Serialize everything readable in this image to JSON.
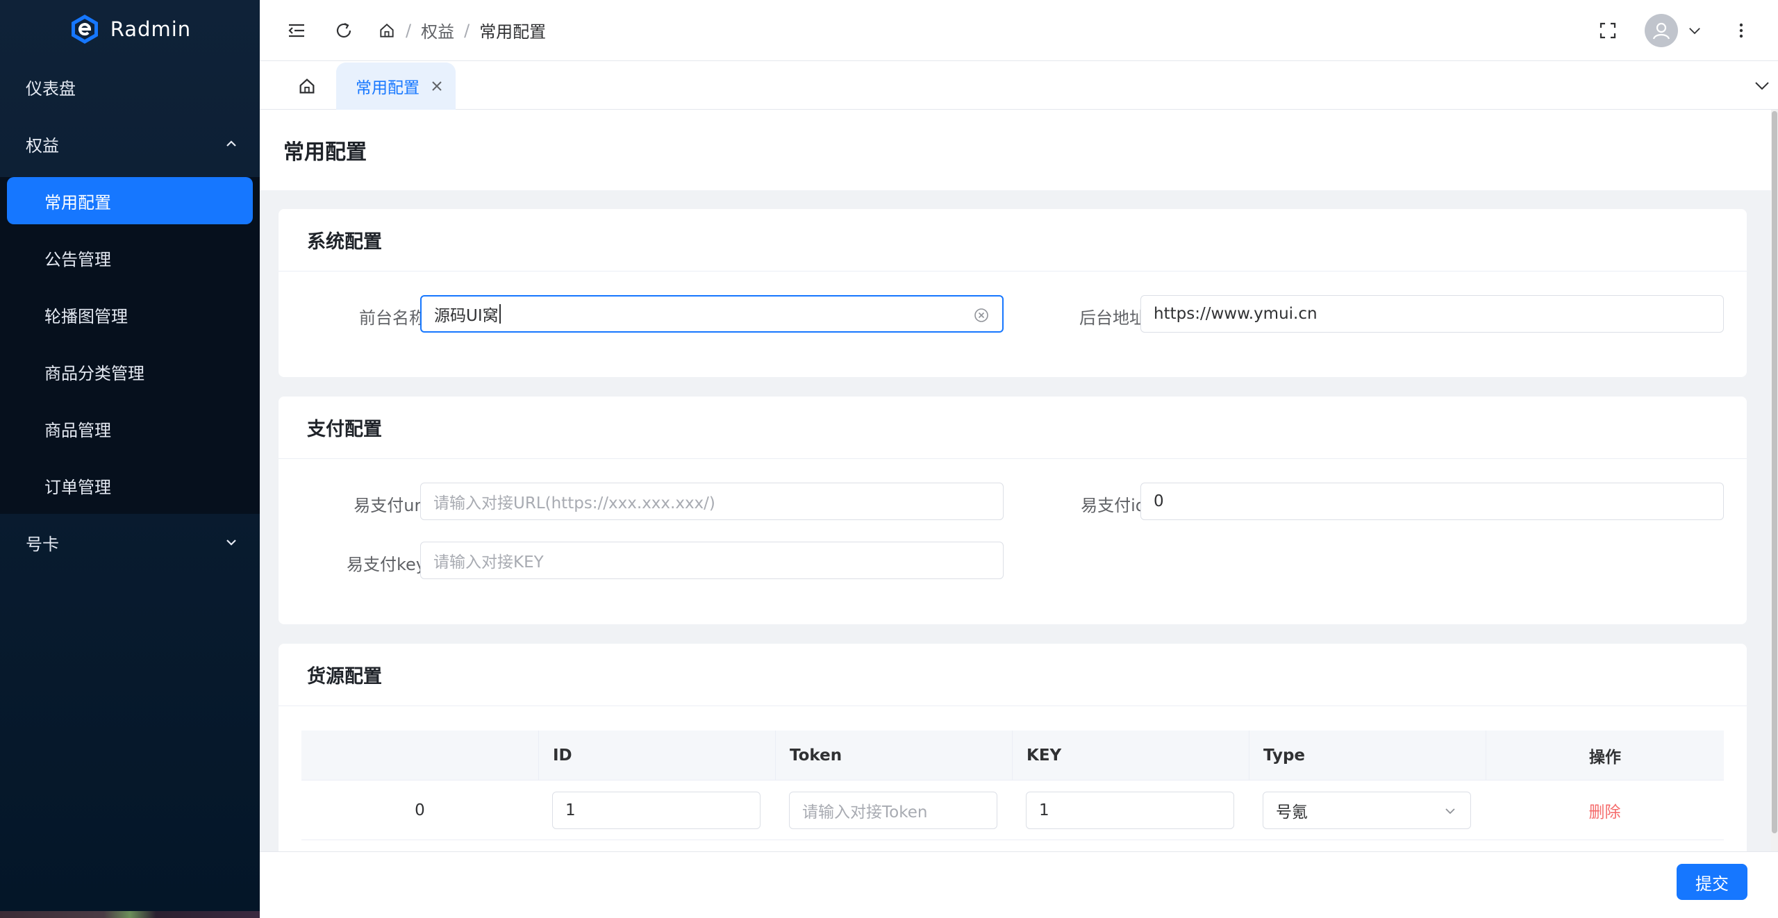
{
  "app": {
    "name": "Radmin"
  },
  "sidebar": {
    "items": [
      {
        "label": "仪表盘"
      },
      {
        "label": "权益",
        "expanded": true,
        "children": [
          {
            "label": "常用配置",
            "active": true
          },
          {
            "label": "公告管理"
          },
          {
            "label": "轮播图管理"
          },
          {
            "label": "商品分类管理"
          },
          {
            "label": "商品管理"
          },
          {
            "label": "订单管理"
          }
        ]
      },
      {
        "label": "号卡",
        "expanded": false
      }
    ]
  },
  "header": {
    "breadcrumb": [
      "权益",
      "常用配置"
    ],
    "separator": "/"
  },
  "tabs": [
    {
      "label": "常用配置",
      "active": true
    }
  ],
  "page": {
    "title": "常用配置"
  },
  "sections": {
    "system": {
      "title": "系统配置",
      "frontend_name_label": "前台名称",
      "frontend_name_value": "源码UI窝",
      "backend_url_label": "后台地址",
      "backend_url_value": "https://www.ymui.cn"
    },
    "payment": {
      "title": "支付配置",
      "url_label": "易支付url",
      "url_placeholder": "请输入对接URL(https://xxx.xxx.xxx/)",
      "id_label": "易支付id",
      "id_value": "0",
      "key_label": "易支付key",
      "key_placeholder": "请输入对接KEY"
    },
    "supply": {
      "title": "货源配置",
      "columns": [
        "",
        "ID",
        "Token",
        "KEY",
        "Type",
        "操作"
      ],
      "rows": [
        {
          "index": "0",
          "id": "1",
          "token_placeholder": "请输入对接Token",
          "key": "1",
          "type": "号氪",
          "action": "删除"
        }
      ]
    }
  },
  "footer": {
    "submit_label": "提交"
  },
  "colors": {
    "primary": "#1677ff",
    "sidebar_bg": "#0f2238",
    "danger": "#f56c6c"
  }
}
